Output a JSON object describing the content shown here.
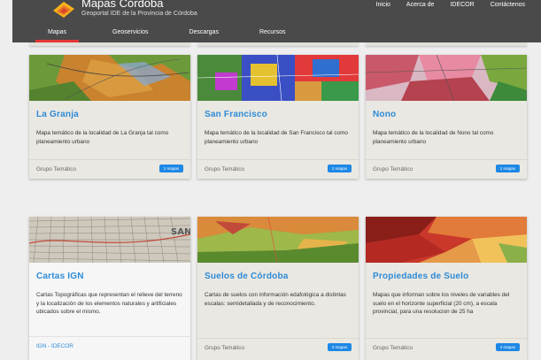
{
  "header": {
    "title": "Mapas Córdoba",
    "subtitle": "Geoportal IDE de la Provincia de Córdoba",
    "top_links": [
      "Inicio",
      "Acerca de",
      "IDECOR",
      "Contáctenos"
    ],
    "tabs": [
      {
        "label": "Mapas",
        "active": true
      },
      {
        "label": "Geoservicios",
        "active": false
      },
      {
        "label": "Descargas",
        "active": false
      },
      {
        "label": "Recursos",
        "active": false
      }
    ]
  },
  "cards": [
    {
      "title": "La Granja",
      "description": "Mapa temático de la localidad de La Granja tal como planeamiento urbano",
      "group": "Grupo Temático",
      "badge": "1 mapas"
    },
    {
      "title": "San Francisco",
      "description": "Mapa temático de la localidad de San Francisco tal como planeamiento urbano",
      "group": "Grupo Temático",
      "badge": "1 mapas"
    },
    {
      "title": "Nono",
      "description": "Mapa temático de la localidad de Nono tal como planeamiento urbano",
      "group": "Grupo Temático",
      "badge": "1 mapas"
    },
    {
      "title": "Cartas IGN",
      "description": "Cartas Topográficas que representan el relieve del terreno y la localización de los elementos naturales y artificiales ubicados sobre el mismo.",
      "group": "IGN - IDECOR",
      "badge": ""
    },
    {
      "title": "Suelos de Córdoba",
      "description": "Cartas de suelos con información edafológica a distintas escalas: semidetallada y de reconocimiento.",
      "group": "Grupo Temático",
      "badge": "3 mapas"
    },
    {
      "title": "Propiedades de Suelo",
      "description": "Mapas que informan sobre los niveles de variables del suelo en el horizonte superficial (20 cm), a escala provincial, para una resolucion de 25 ha",
      "group": "Grupo Temático",
      "badge": "4 mapas"
    }
  ]
}
